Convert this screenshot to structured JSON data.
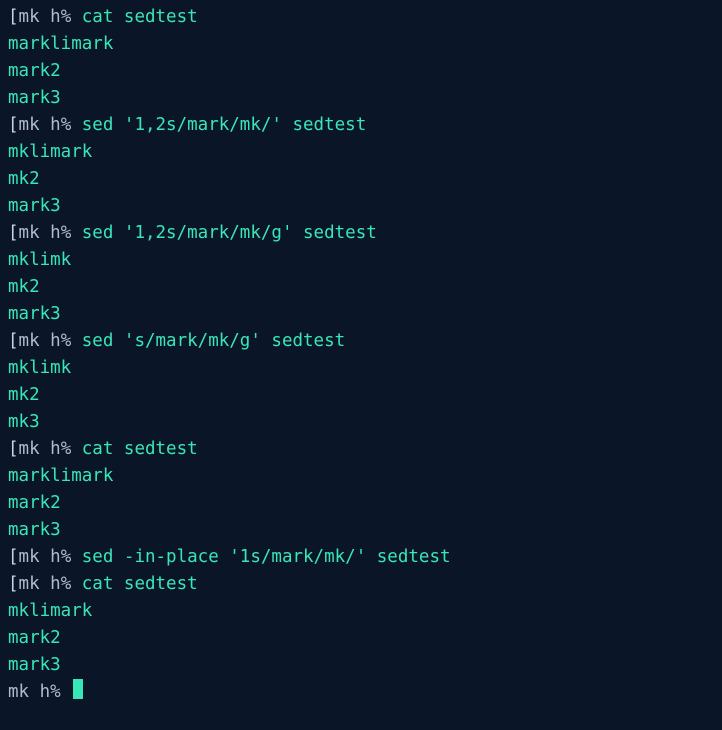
{
  "colors": {
    "background": "#0a1628",
    "bracket": "#c9d4e0",
    "prompt_text": "#b0bcc9",
    "command_text": "#39e6b7",
    "output_text": "#39e6b7",
    "cursor": "#39e6b7"
  },
  "prompt": {
    "open_bracket": "[",
    "text": "mk h% "
  },
  "lines": [
    {
      "type": "cmd",
      "command": "cat sedtest"
    },
    {
      "type": "out",
      "text": "marklimark"
    },
    {
      "type": "out",
      "text": "mark2"
    },
    {
      "type": "out",
      "text": "mark3"
    },
    {
      "type": "cmd",
      "command": "sed '1,2s/mark/mk/' sedtest"
    },
    {
      "type": "out",
      "text": "mklimark"
    },
    {
      "type": "out",
      "text": "mk2"
    },
    {
      "type": "out",
      "text": "mark3"
    },
    {
      "type": "cmd",
      "command": "sed '1,2s/mark/mk/g' sedtest"
    },
    {
      "type": "out",
      "text": "mklimk"
    },
    {
      "type": "out",
      "text": "mk2"
    },
    {
      "type": "out",
      "text": "mark3"
    },
    {
      "type": "cmd",
      "command": "sed 's/mark/mk/g' sedtest"
    },
    {
      "type": "out",
      "text": "mklimk"
    },
    {
      "type": "out",
      "text": "mk2"
    },
    {
      "type": "out",
      "text": "mk3"
    },
    {
      "type": "cmd",
      "command": "cat sedtest"
    },
    {
      "type": "out",
      "text": "marklimark"
    },
    {
      "type": "out",
      "text": "mark2"
    },
    {
      "type": "out",
      "text": "mark3"
    },
    {
      "type": "cmd",
      "command": "sed -in-place '1s/mark/mk/' sedtest"
    },
    {
      "type": "cmd",
      "command": "cat sedtest"
    },
    {
      "type": "out",
      "text": "mklimark"
    },
    {
      "type": "out",
      "text": "mark2"
    },
    {
      "type": "out",
      "text": "mark3"
    },
    {
      "type": "prompt-only"
    }
  ]
}
